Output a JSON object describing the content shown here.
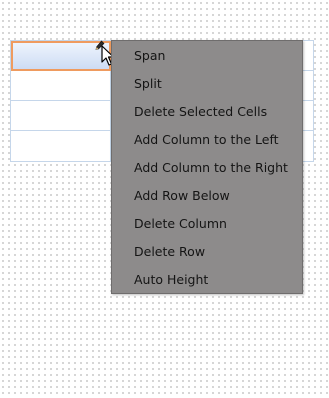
{
  "table": {
    "rows": 4,
    "columns": 2,
    "selected_cell": "row-1-col-1"
  },
  "context_menu": {
    "items": [
      {
        "label": "Span"
      },
      {
        "label": "Split"
      },
      {
        "label": "Delete Selected Cells"
      },
      {
        "label": "Add Column to the Left"
      },
      {
        "label": "Add Column to the Right"
      },
      {
        "label": "Add Row Below"
      },
      {
        "label": "Delete Column"
      },
      {
        "label": "Delete Row"
      },
      {
        "label": "Auto Height"
      }
    ]
  },
  "icons": {
    "edit": "pencil-icon",
    "pointer": "mouse-cursor-icon"
  },
  "colors": {
    "menu_background": "#8d8b8b",
    "selected_cell_border": "#ef9b5f",
    "grid_lines": "#c5d6ea"
  }
}
